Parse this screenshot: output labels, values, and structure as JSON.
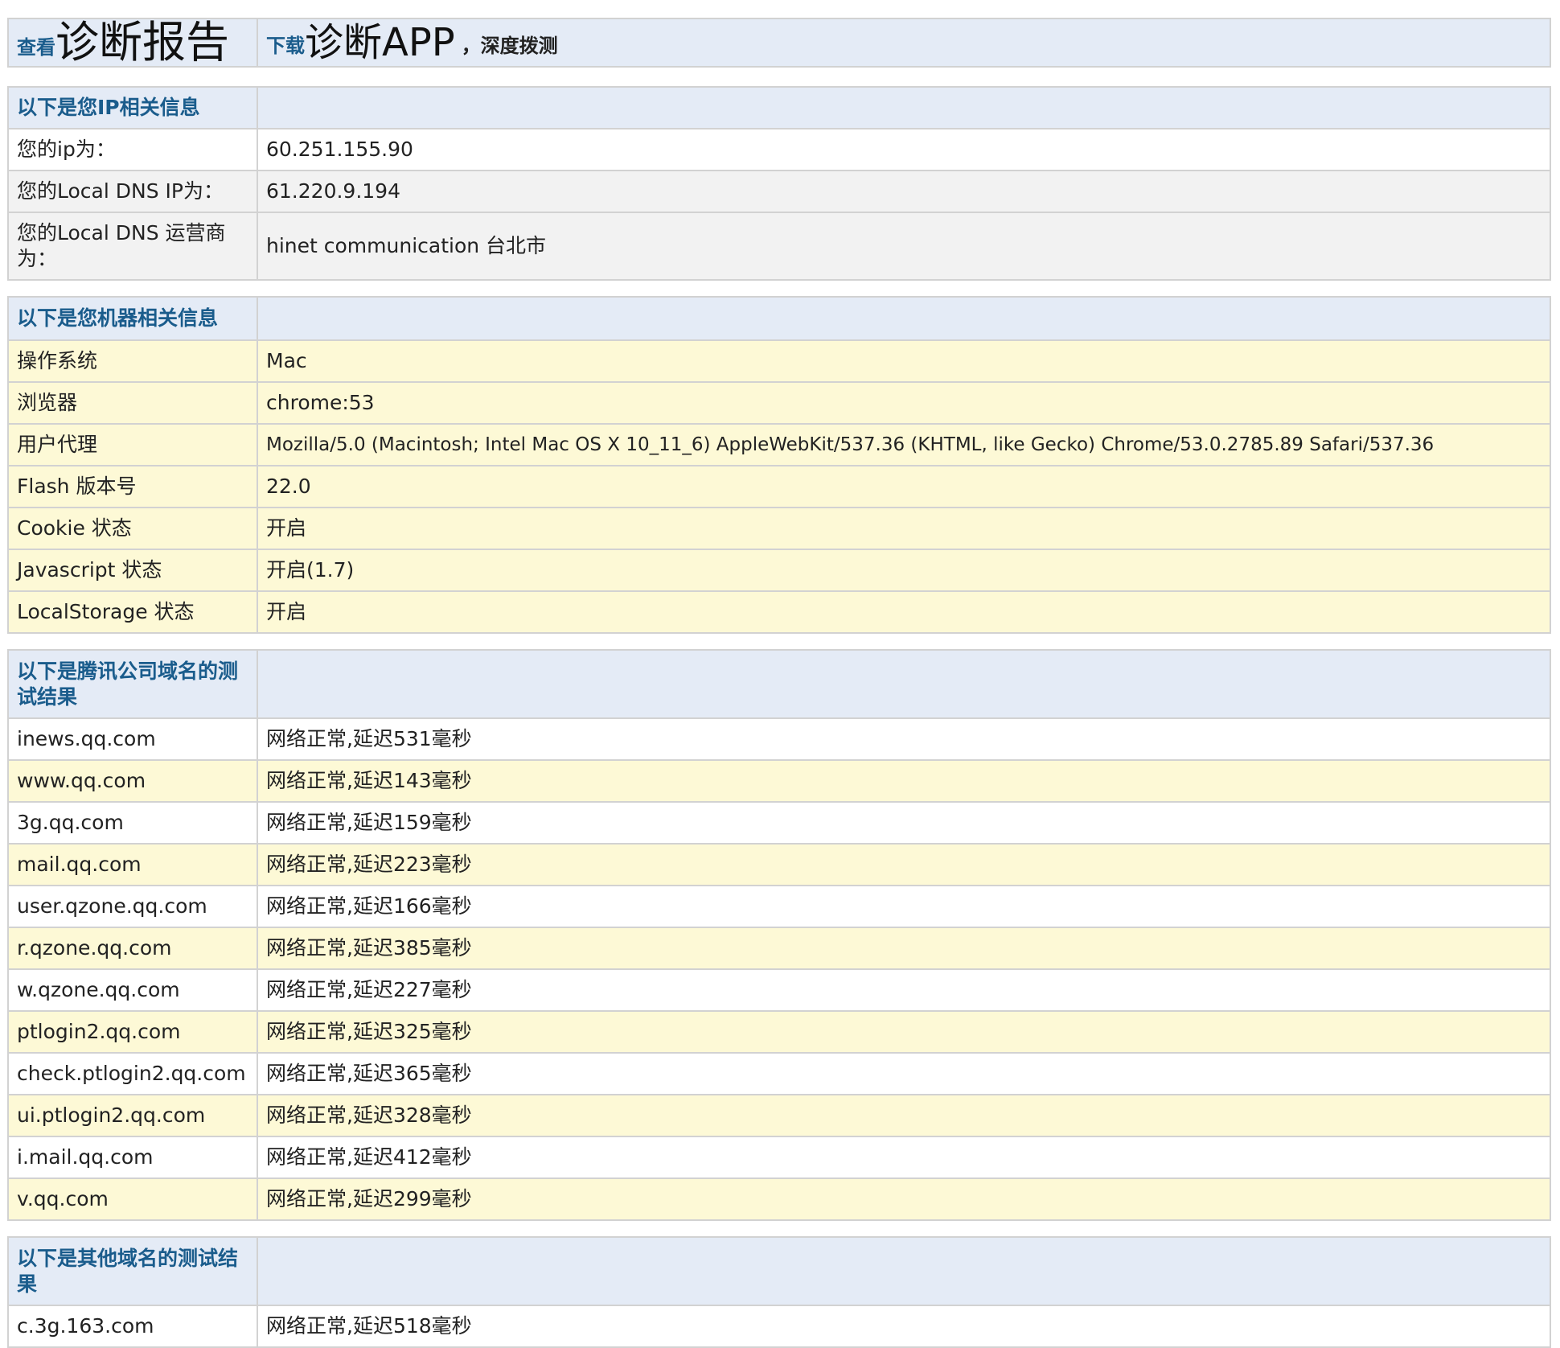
{
  "top_bar": {
    "view_prefix": "查看",
    "view_title": "诊断报告",
    "download_prefix": "下载",
    "download_title": "诊断APP",
    "deep_probe": "，深度拨测"
  },
  "ip_info": {
    "header": "以下是您IP相关信息",
    "rows": [
      {
        "label": "您的ip为：",
        "value": "60.251.155.90"
      },
      {
        "label": "您的Local DNS IP为：",
        "value": "61.220.9.194"
      },
      {
        "label": "您的Local DNS 运营商为：",
        "value": "hinet communication 台北市"
      }
    ]
  },
  "machine_info": {
    "header": "以下是您机器相关信息",
    "rows": [
      {
        "label": "操作系统",
        "value": "Mac"
      },
      {
        "label": "浏览器",
        "value": "chrome:53"
      },
      {
        "label": "用户代理",
        "value": "Mozilla/5.0 (Macintosh; Intel Mac OS X 10_11_6) AppleWebKit/537.36 (KHTML, like Gecko) Chrome/53.0.2785.89 Safari/537.36"
      },
      {
        "label": "Flash 版本号",
        "value": "22.0"
      },
      {
        "label": "Cookie 状态",
        "value": "开启"
      },
      {
        "label": "Javascript 状态",
        "value": "开启(1.7)"
      },
      {
        "label": "LocalStorage 状态",
        "value": "开启"
      }
    ]
  },
  "tencent_results": {
    "header": "以下是腾讯公司域名的测试结果",
    "rows": [
      {
        "domain": "inews.qq.com",
        "result": "网络正常,延迟531毫秒"
      },
      {
        "domain": "www.qq.com",
        "result": "网络正常,延迟143毫秒"
      },
      {
        "domain": "3g.qq.com",
        "result": "网络正常,延迟159毫秒"
      },
      {
        "domain": "mail.qq.com",
        "result": "网络正常,延迟223毫秒"
      },
      {
        "domain": "user.qzone.qq.com",
        "result": "网络正常,延迟166毫秒"
      },
      {
        "domain": "r.qzone.qq.com",
        "result": "网络正常,延迟385毫秒"
      },
      {
        "domain": "w.qzone.qq.com",
        "result": "网络正常,延迟227毫秒"
      },
      {
        "domain": "ptlogin2.qq.com",
        "result": "网络正常,延迟325毫秒"
      },
      {
        "domain": "check.ptlogin2.qq.com",
        "result": "网络正常,延迟365毫秒"
      },
      {
        "domain": "ui.ptlogin2.qq.com",
        "result": "网络正常,延迟328毫秒"
      },
      {
        "domain": "i.mail.qq.com",
        "result": "网络正常,延迟412毫秒"
      },
      {
        "domain": "v.qq.com",
        "result": "网络正常,延迟299毫秒"
      }
    ]
  },
  "other_results": {
    "header": "以下是其他域名的测试结果",
    "rows": [
      {
        "domain": "c.3g.163.com",
        "result": "网络正常,延迟518毫秒"
      }
    ]
  }
}
